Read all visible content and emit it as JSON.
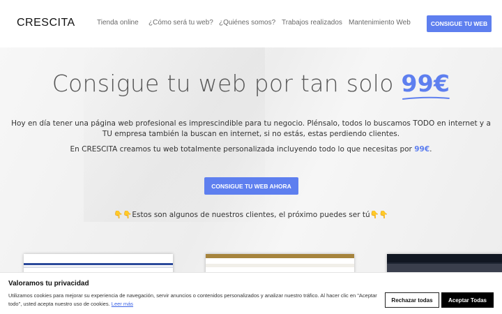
{
  "header": {
    "logo": "CRESCITA",
    "nav": [
      "Tienda online",
      "¿Cómo será tu web?",
      "¿Quiénes somos?",
      "Trabajos realizados",
      "Mantenimiento Web"
    ],
    "cta": "CONSIGUE TU WEB"
  },
  "hero": {
    "headline": "Consigue tu web por tan solo ",
    "price": "99€",
    "paragraph1": "Hoy en día tener una página web profesional es imprescindible para tu negocio. Plénsalo, todos lo buscamos TODO en internet y a TU empresa también la buscan en internet, si no estás, estas perdiendo clientes.",
    "paragraph2_before": "En CRESCITA creamos tu web totalmente personalizada incluyendo todo lo que necesitas por ",
    "paragraph2_price": "99€",
    "paragraph2_after": ".",
    "cta": "CONSIGUE TU WEB AHORA",
    "clients_text": "Estos son algunos de nuestros clientes, el próximo puedes ser tú"
  },
  "colors": {
    "accent": "#5e7fef",
    "cookie_accept_bg": "#000000"
  },
  "cookie_banner": {
    "title": "Valoramos tu privacidad",
    "text": "Utilizamos cookies para mejorar su experiencia de navegación, servir anuncios o contenidos personalizados y analizar nuestro tráfico. Al hacer clic en \"Aceptar todo\", usted acepta nuestro uso de cookies.",
    "link": "Leer más",
    "reject": "Rechazar todas",
    "accept": "Aceptar Todas"
  }
}
